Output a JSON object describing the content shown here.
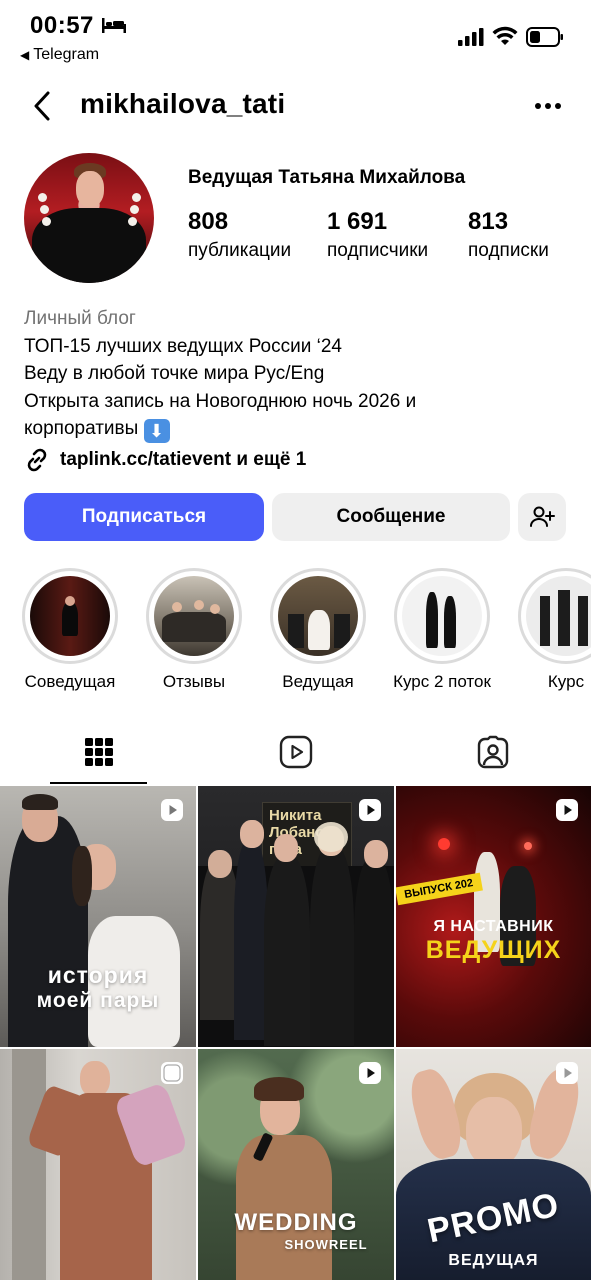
{
  "status_bar": {
    "time": "00:57",
    "back_app": "Telegram"
  },
  "header": {
    "username": "mikhailova_tati"
  },
  "profile": {
    "display_name": "Ведущая Татьяна Михайлова",
    "stats": [
      {
        "value": "808",
        "label": "публикации"
      },
      {
        "value": "1 691",
        "label": "подписчики"
      },
      {
        "value": "813",
        "label": "подписки"
      }
    ],
    "category": "Личный блог",
    "bio_lines": [
      "ТОП-15 лучших ведущих России ‘24",
      "Веду в любой точке мира Рус/Eng",
      "Открыта запись на Новогоднюю ночь 2026 и",
      "корпоративы"
    ],
    "bio_emoji": "⬇",
    "link": "taplink.cc/tatievent и ещё 1"
  },
  "actions": {
    "follow": "Подписаться",
    "message": "Сообщение"
  },
  "highlights": [
    {
      "label": "Соведущая"
    },
    {
      "label": "Отзывы"
    },
    {
      "label": "Ведущая"
    },
    {
      "label": "Курс 2 поток"
    },
    {
      "label": "Курс"
    }
  ],
  "posts": [
    {
      "caption_line1": "история",
      "caption_line2": "моей пары"
    },
    {
      "overlay": "Никита Лобанов",
      "overlay2": "года"
    },
    {
      "small": "ВЫПУСК 202",
      "caption_line1": "Я НАСТАВНИК",
      "caption_line2": "ВЕДУЩИХ"
    },
    {},
    {
      "caption_line1": "WEDDING",
      "caption_line2": "SHOWREEL"
    },
    {
      "caption_line1": "PROMO",
      "caption_line2": "ВЕДУЩАЯ"
    }
  ],
  "colors": {
    "follow_button": "#4a5df9",
    "secondary_button": "#efefef",
    "category_text": "#737373"
  }
}
